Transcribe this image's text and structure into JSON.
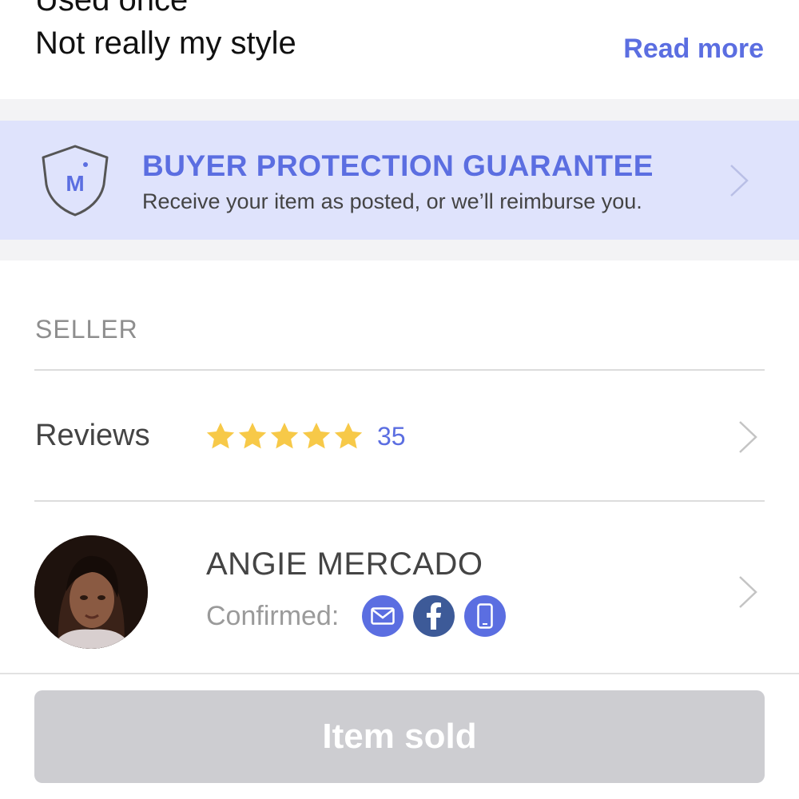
{
  "listing": {
    "description_partial": "Used once",
    "description": "Not really my style",
    "read_more": "Read more"
  },
  "guarantee": {
    "title": "BUYER PROTECTION GUARANTEE",
    "subtitle": "Receive your item as posted, or we’ll reimburse you.",
    "shield_letter": "M",
    "icon": "shield-icon"
  },
  "seller": {
    "heading": "SELLER",
    "reviews_label": "Reviews",
    "rating": 5,
    "rating_max": 5,
    "review_count": "35",
    "name": "ANGIE MERCADO",
    "confirmed_label": "Confirmed:",
    "confirmations": [
      "email-icon",
      "facebook-icon",
      "phone-icon"
    ]
  },
  "footer": {
    "button_label": "Item sold"
  },
  "colors": {
    "accent": "#5b6ee1",
    "guarantee_bg": "#dfe3fc",
    "star": "#f7c948",
    "facebook": "#3d5a98",
    "disabled_button": "#cdcdd1"
  }
}
